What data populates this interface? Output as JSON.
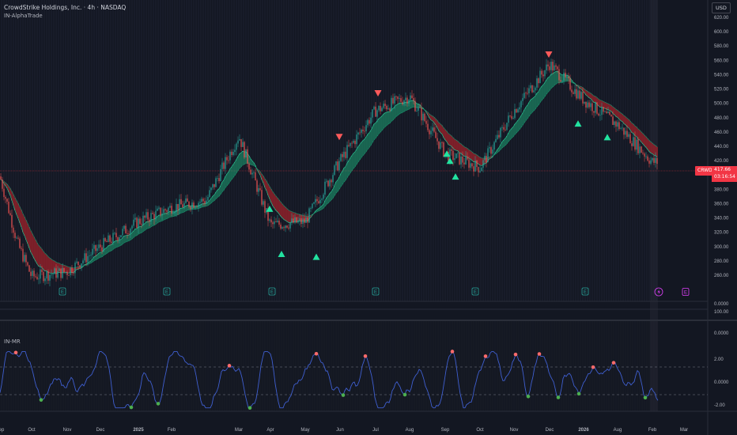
{
  "header": {
    "title": "CrowdStrike Holdings, Inc. · 4h · NASDAQ",
    "indicator": "IN-AlphaTrade"
  },
  "oscillator": {
    "label": "IN-MR"
  },
  "currency": "USD",
  "last_price": {
    "ticker": "CRWD",
    "value": "417.66",
    "countdown": "03:16:54"
  },
  "colors": {
    "background": "#131722",
    "up": "#26a69a",
    "down": "#ef5350",
    "ribbon_bull": "#1fbf86",
    "ribbon_bear": "#b2222a",
    "osc_line": "#3f5fd0",
    "accent_red": "#f23645"
  },
  "icons": {
    "earnings": "earnings-E-icon",
    "split": "flash-icon"
  },
  "chart_data": [
    {
      "type": "candlestick",
      "ylim": [
        0,
        620
      ],
      "y_ticks": [
        "620.00",
        "600.00",
        "580.00",
        "560.00",
        "540.00",
        "520.00",
        "500.00",
        "480.00",
        "460.00",
        "440.00",
        "420.00",
        "400.00",
        "380.00",
        "360.00",
        "340.00",
        "320.00",
        "300.00",
        "280.00",
        "260.00",
        "0.0000"
      ],
      "x_ticks": [
        "Aug",
        "Sep",
        "Oct",
        "Nov",
        "Dec",
        "2025",
        "Feb",
        "Mar",
        "Apr",
        "May",
        "Jun",
        "Jul",
        "Aug",
        "Sep",
        "Oct",
        "Nov",
        "Dec",
        "2026",
        "Feb",
        "Mar"
      ],
      "price_path_approx": [
        {
          "x": "Jul",
          "y": 398
        },
        {
          "x": "late Jul",
          "y": 305
        },
        {
          "x": "Aug",
          "y": 258
        },
        {
          "x": "Sep",
          "y": 265
        },
        {
          "x": "Oct",
          "y": 300
        },
        {
          "x": "Nov",
          "y": 335
        },
        {
          "x": "Dec",
          "y": 355
        },
        {
          "x": "2025",
          "y": 365
        },
        {
          "x": "Feb",
          "y": 455
        },
        {
          "x": "Mar",
          "y": 330
        },
        {
          "x": "Apr",
          "y": 335
        },
        {
          "x": "May",
          "y": 420
        },
        {
          "x": "Jun",
          "y": 490
        },
        {
          "x": "Jul",
          "y": 510
        },
        {
          "x": "Aug",
          "y": 430
        },
        {
          "x": "Sep",
          "y": 410
        },
        {
          "x": "Oct",
          "y": 490
        },
        {
          "x": "Nov",
          "y": 555
        },
        {
          "x": "Dec",
          "y": 505
        },
        {
          "x": "2026",
          "y": 470
        },
        {
          "x": "Feb",
          "y": 418
        }
      ],
      "buy_signals_approx": [
        {
          "x": "Feb",
          "y": 365
        },
        {
          "x": "Mar",
          "y": 302
        },
        {
          "x": "Apr",
          "y": 298
        },
        {
          "x": "Aug",
          "y": 442
        },
        {
          "x": "Aug",
          "y": 432
        },
        {
          "x": "Aug",
          "y": 410
        },
        {
          "x": "Nov",
          "y": 484
        },
        {
          "x": "Dec",
          "y": 465
        }
      ],
      "sell_signals_approx": [
        {
          "x": "Apr",
          "y": 442
        },
        {
          "x": "Jun",
          "y": 503
        },
        {
          "x": "Oct",
          "y": 557
        }
      ],
      "earnings_markers": [
        "Aug",
        "Nov",
        "Mar",
        "Jun",
        "Sep",
        "Dec"
      ]
    },
    {
      "type": "line",
      "name": "IN-MR",
      "ylim": [
        -2.5,
        3
      ],
      "y_ticks": [
        "0.0000",
        "2.00",
        "0.0000",
        "-2.00"
      ],
      "upper_band": 1.2,
      "lower_band": -1.2
    }
  ]
}
